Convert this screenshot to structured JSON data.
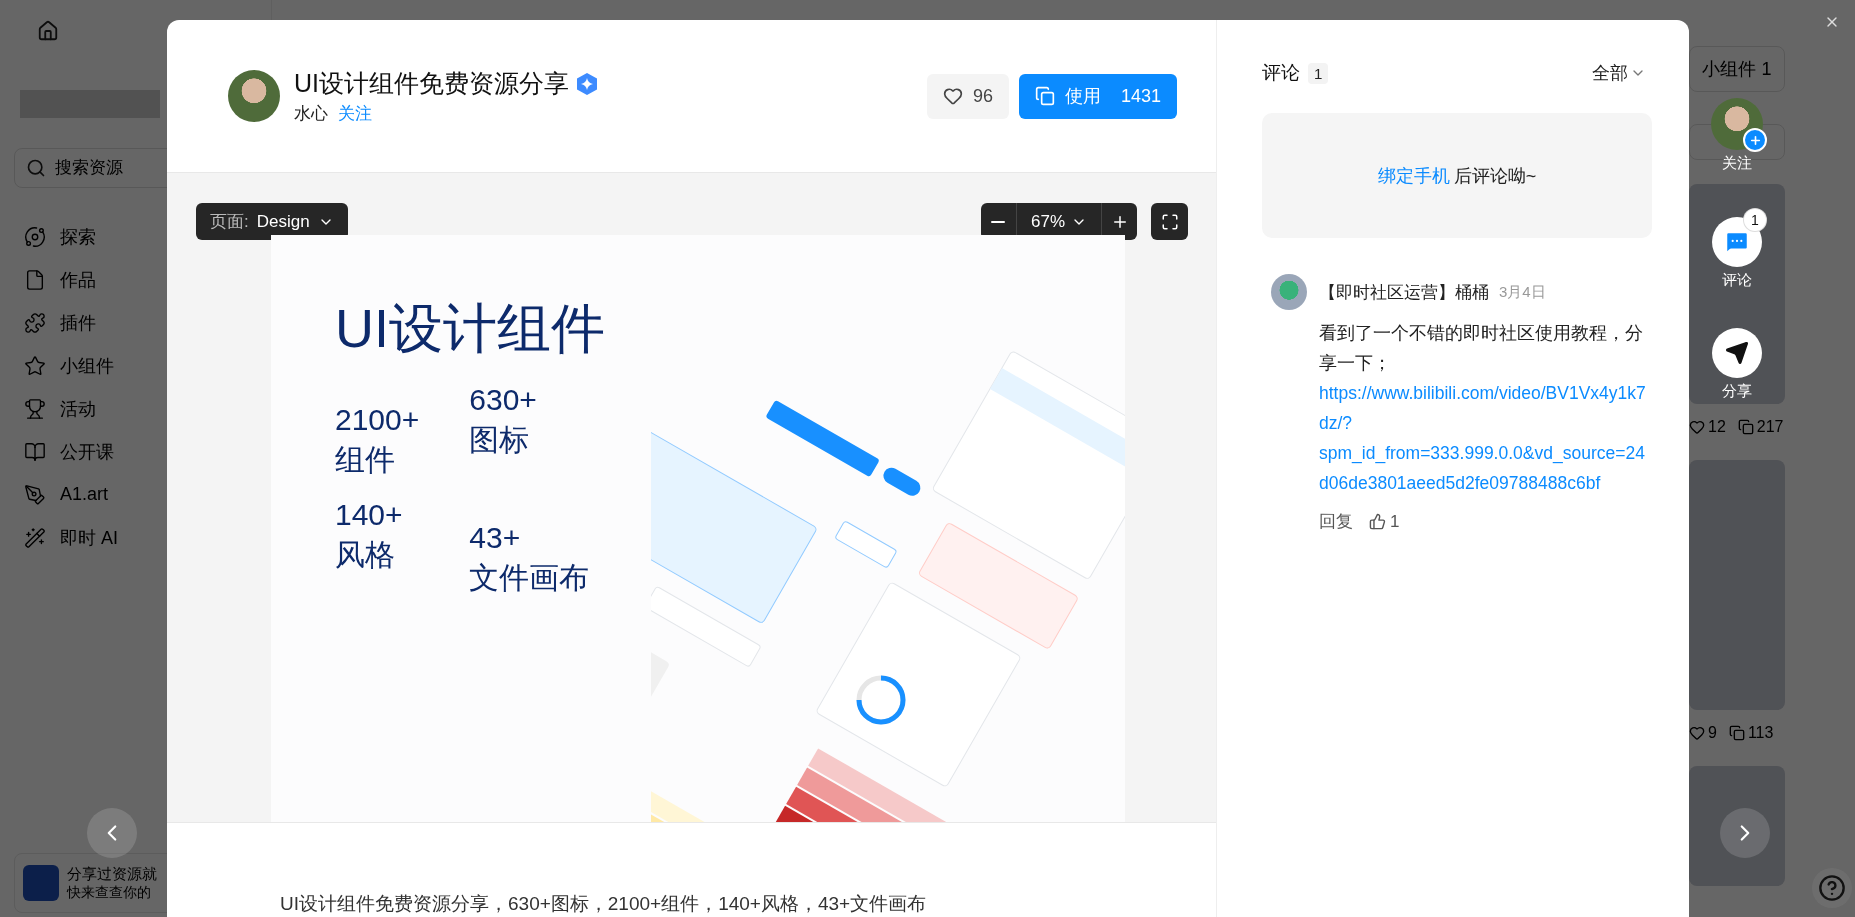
{
  "sidebar": {
    "search": {
      "placeholder": "搜索资源"
    },
    "items": [
      {
        "label": "探索"
      },
      {
        "label": "作品"
      },
      {
        "label": "插件"
      },
      {
        "label": "小组件"
      },
      {
        "label": "活动"
      },
      {
        "label": "公开课"
      },
      {
        "label": "A1.art"
      },
      {
        "label": "即时 AI"
      }
    ],
    "promo": {
      "title": "分享过资源就",
      "subtitle": "快来查查你的"
    }
  },
  "feed": {
    "tab": "小组件 1",
    "cards": [
      {
        "likes": "12",
        "copies": "217"
      },
      {
        "likes": "9",
        "copies": "113"
      }
    ]
  },
  "modal": {
    "title": "UI设计组件免费资源分享",
    "author": "水心",
    "follow": "关注",
    "likes": "96",
    "use_label": "使用",
    "use_count": "1431",
    "page_label": "页面:",
    "page_name": "Design",
    "zoom": "67%",
    "preview": {
      "title": "UI设计组件",
      "stats": [
        {
          "value": "2100+",
          "label": "组件"
        },
        {
          "value": "630+",
          "label": "图标"
        },
        {
          "value": "140+",
          "label": "风格"
        },
        {
          "value": "43+",
          "label": "文件画布"
        }
      ]
    },
    "description": "UI设计组件免费资源分享，630+图标，2100+组件，140+风格，43+文件画布"
  },
  "comments": {
    "title": "评论",
    "count": "1",
    "filter": "全部",
    "bind_link": "绑定手机",
    "bind_text": "后评论呦~",
    "items": [
      {
        "author": "【即时社区运营】桶桶",
        "date": "3月4日",
        "text": "看到了一个不错的即时社区使用教程，分享一下；",
        "link": "https://www.bilibili.com/video/BV1Vx4y1k7dz/?spm_id_from=333.999.0.0&vd_source=24d06de3801aeed5d2fe09788488c6bf",
        "reply": "回复",
        "likes": "1"
      }
    ]
  },
  "side_actions": [
    {
      "kind": "follow",
      "label": "关注"
    },
    {
      "kind": "comment",
      "label": "评论",
      "badge": "1"
    },
    {
      "kind": "share",
      "label": "分享"
    }
  ]
}
